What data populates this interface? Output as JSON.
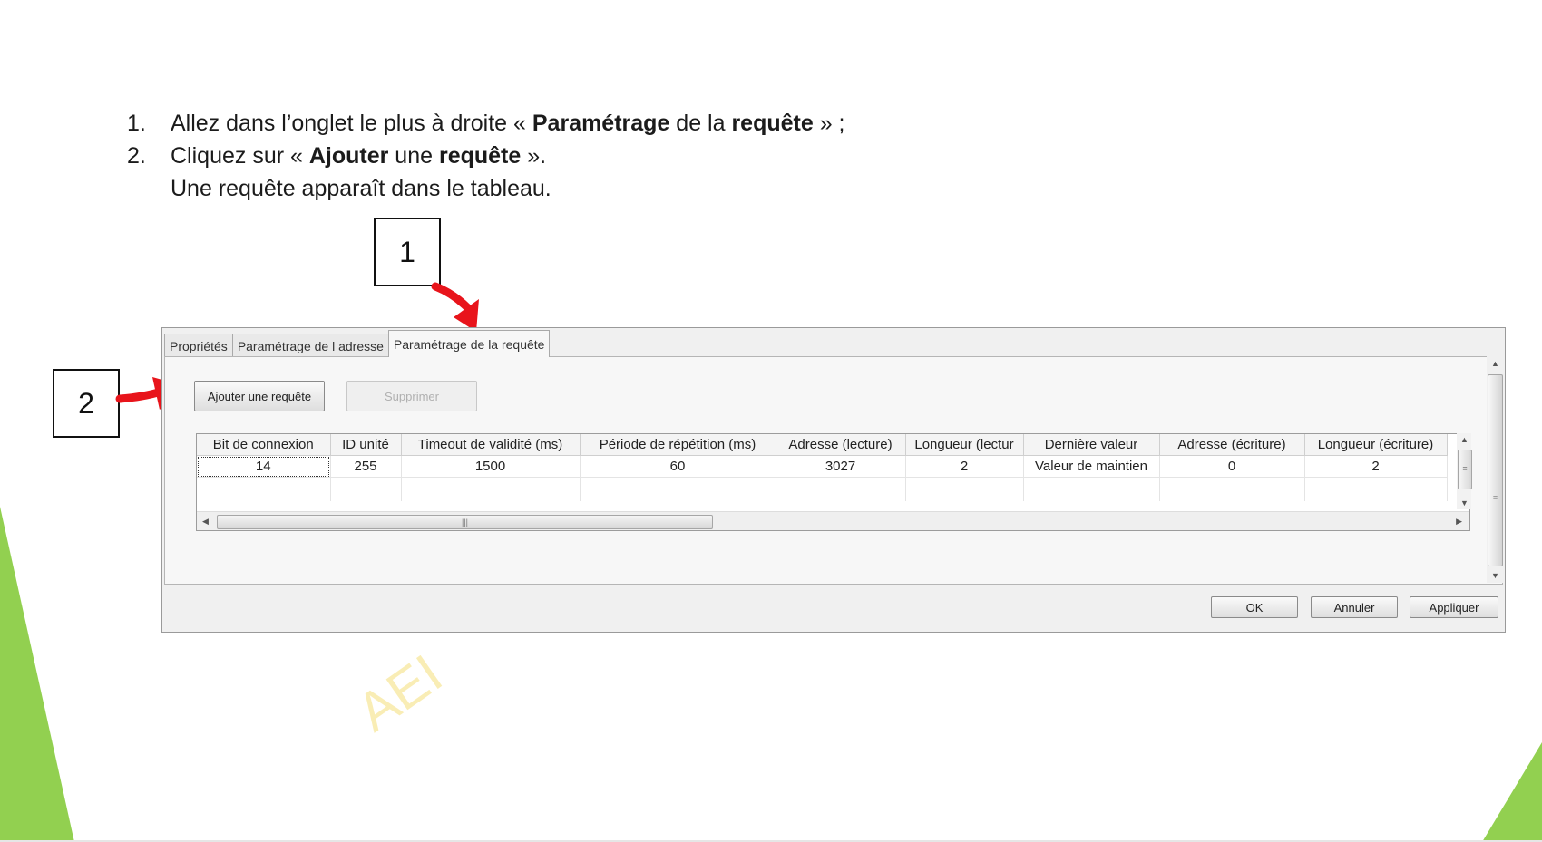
{
  "instructions": {
    "step1": {
      "num": "1.",
      "before": "Allez dans l’onglet le plus à droite « ",
      "bold1": "Paramétrage",
      "middle": " de la ",
      "bold2": "requête",
      "after": " » ;"
    },
    "step2": {
      "num": "2.",
      "before": "Cliquez sur « ",
      "bold1": "Ajouter",
      "middle": " une ",
      "bold2": "requête",
      "after": " »."
    },
    "note": "Une requête apparaît dans le tableau."
  },
  "callouts": {
    "one": "1",
    "two": "2"
  },
  "dialog": {
    "tabs": [
      "Propriétés",
      "Paramétrage de l adresse",
      "Paramétrage de la requête"
    ],
    "active_tab": 2,
    "buttons": {
      "add": "Ajouter une requête",
      "delete": "Supprimer"
    },
    "table": {
      "columns": [
        "Bit de connexion",
        "ID unité",
        "Timeout de validité (ms)",
        "Période de répétition (ms)",
        "Adresse (lecture)",
        "Longueur (lectur",
        "Dernière valeur",
        "Adresse (écriture)",
        "Longueur (écriture)"
      ],
      "rows": [
        [
          "14",
          "255",
          "1500",
          "60",
          "3027",
          "2",
          "Valeur de maintien",
          "0",
          "2"
        ]
      ]
    },
    "footer": {
      "ok": "OK",
      "cancel": "Annuler",
      "apply": "Appliquer"
    }
  },
  "watermark": "AEI",
  "colors": {
    "accent_green": "#92d050",
    "arrow_red": "#e8141b"
  }
}
